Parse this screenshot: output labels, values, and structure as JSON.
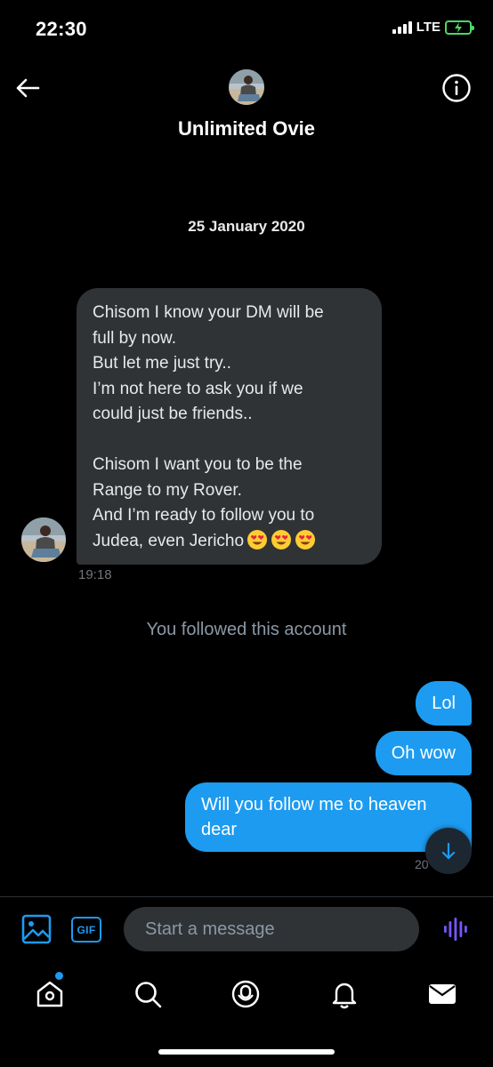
{
  "status_bar": {
    "time": "22:30",
    "network": "LTE"
  },
  "header": {
    "contact_name": "Unlimited Ovie"
  },
  "conversation": {
    "date": "25 January 2020",
    "incoming": {
      "lines": [
        "Chisom I know your DM will be",
        "full by now.",
        "But let me just try..",
        "I’m not here to ask you if we",
        "could just be friends..",
        "",
        "Chisom I want you to be the",
        "Range to my Rover.",
        "And I’m ready to follow you to",
        "Judea, even Jericho"
      ],
      "emoji": "heart-eyes x3",
      "time": "19:18"
    },
    "system_message": "You followed this account",
    "outgoing": [
      {
        "text": "Lol"
      },
      {
        "text": "Oh wow"
      },
      {
        "text": "Will you follow me to heaven dear"
      }
    ],
    "outgoing_time": "20"
  },
  "composer": {
    "gif_label": "GIF",
    "placeholder": "Start a message"
  },
  "colors": {
    "accent": "#1d9bf0",
    "bubble_in": "#2f3336",
    "voice": "#7856ff",
    "battery": "#4cd964"
  }
}
